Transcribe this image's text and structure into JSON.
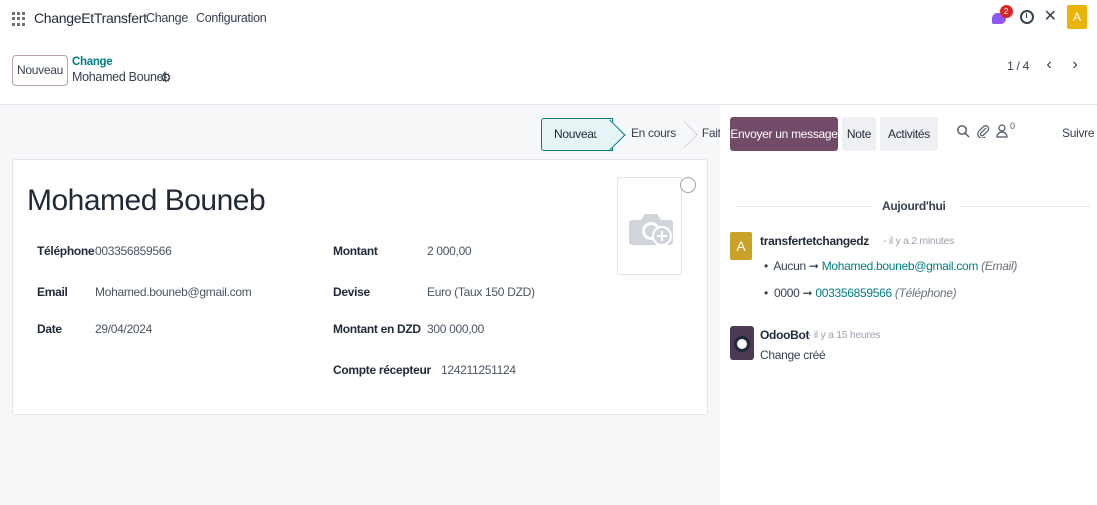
{
  "navbar": {
    "brand": "ChangeEtTransfert",
    "menus": [
      "Change",
      "Configuration"
    ],
    "chat_badge": "2",
    "user_initial": "A"
  },
  "control": {
    "new_button": "Nouveau",
    "breadcrumb_parent": "Change",
    "breadcrumb_current": "Mohamed Bouneb",
    "pager_value": "1 / 4"
  },
  "statusbar": {
    "stages": [
      "Nouveau",
      "En cours",
      "Fait"
    ],
    "active": "Nouveau"
  },
  "record": {
    "name": "Mohamed Bouneb",
    "left_fields": [
      {
        "label": "Téléphone",
        "value": "003356859566"
      },
      {
        "label": "Email",
        "value": "Mohamed.bouneb@gmail.com"
      },
      {
        "label": "Date",
        "value": "29/04/2024"
      }
    ],
    "right_fields": [
      {
        "label": "Montant",
        "value": "2 000,00"
      },
      {
        "label": "Devise",
        "value": "Euro (Taux 150 DZD)"
      },
      {
        "label": "Montant en DZD",
        "value": "300 000,00"
      },
      {
        "label": "Compte récepteur",
        "value": "124211251124"
      }
    ]
  },
  "chatter": {
    "send_message": "Envoyer un message",
    "note": "Note",
    "activities": "Activités",
    "follower_count": "0",
    "follow": "Suivre",
    "date_separator": "Aujourd'hui",
    "messages": [
      {
        "avatar": "A",
        "author": "transfertetchangedz",
        "time": "- il y a 2 minutes",
        "changes": [
          {
            "old": "Aucun",
            "new": "Mohamed.bouneb@gmail.com",
            "field": "(Email)"
          },
          {
            "old": "0000",
            "new": "003356859566",
            "field": "(Téléphone)"
          }
        ]
      },
      {
        "author": "OdooBot",
        "time": "- il y a 15 heures",
        "body": "Change créé"
      }
    ]
  },
  "colors": {
    "primary": "#714b67",
    "link": "#017e84",
    "badge": "#dc2626",
    "user_avatar": "#eab308"
  }
}
